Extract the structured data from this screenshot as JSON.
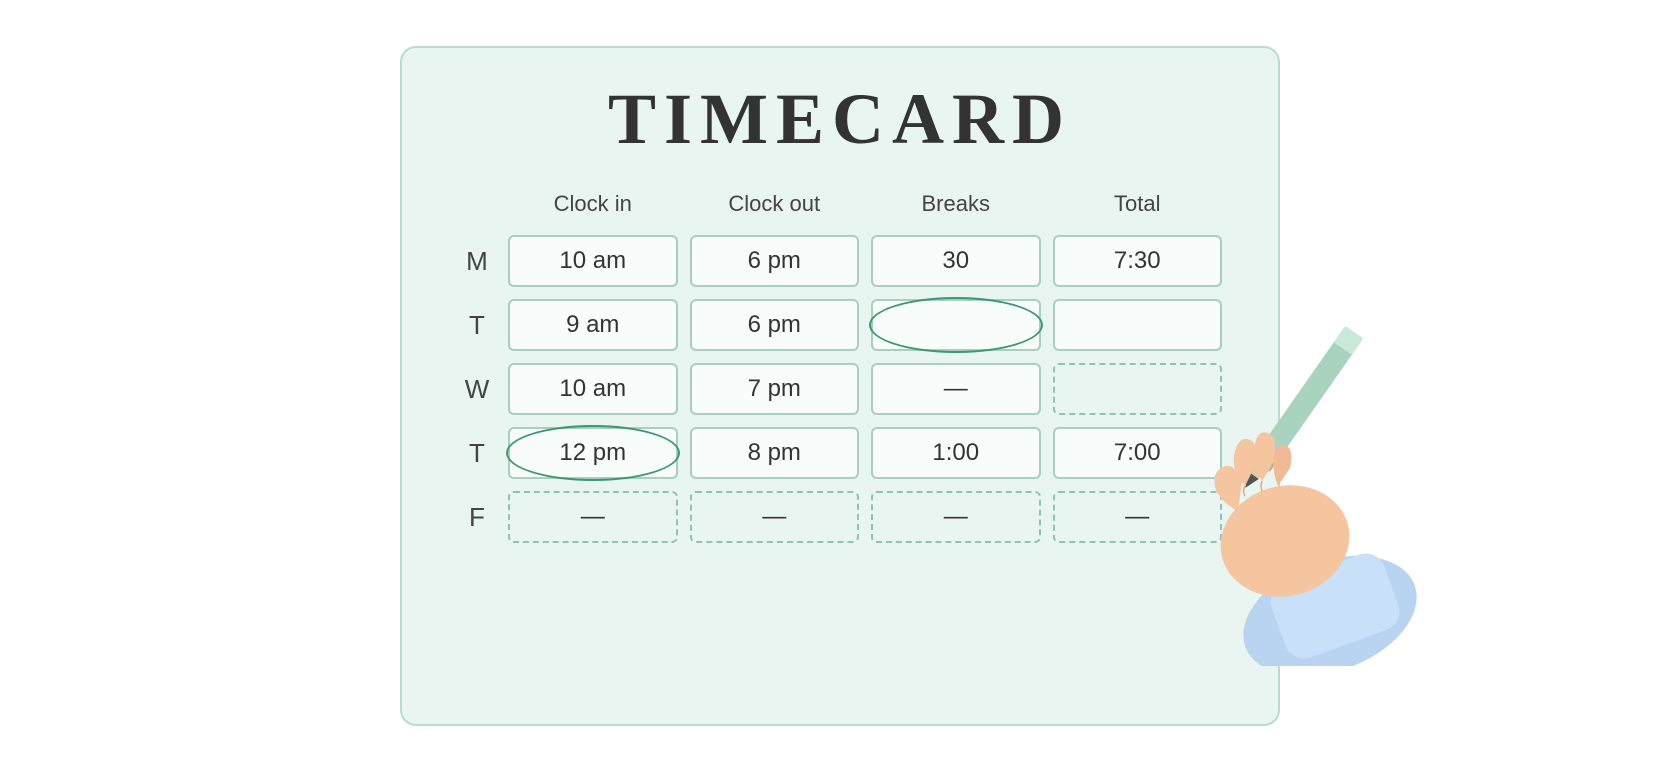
{
  "title": "TIMECARD",
  "columns": {
    "day": "",
    "clock_in": "Clock in",
    "clock_out": "Clock out",
    "breaks": "Breaks",
    "total": "Total"
  },
  "rows": [
    {
      "day": "M",
      "clock_in": "10 am",
      "clock_out": "6 pm",
      "breaks": "30",
      "total": "7:30",
      "clock_in_style": "solid",
      "clock_out_style": "solid",
      "breaks_style": "solid",
      "total_style": "solid",
      "clock_in_circled": false
    },
    {
      "day": "T",
      "clock_in": "9 am",
      "clock_out": "6 pm",
      "breaks": "",
      "total": "",
      "clock_in_style": "solid",
      "clock_out_style": "solid",
      "breaks_style": "solid",
      "total_style": "solid",
      "clock_in_circled": false
    },
    {
      "day": "W",
      "clock_in": "10 am",
      "clock_out": "7 pm",
      "breaks": "—",
      "total": "",
      "clock_in_style": "solid",
      "clock_out_style": "solid",
      "breaks_style": "solid",
      "total_style": "dashed",
      "clock_in_circled": false
    },
    {
      "day": "T",
      "clock_in": "12 pm",
      "clock_out": "8 pm",
      "breaks": "1:00",
      "total": "7:00",
      "clock_in_style": "solid",
      "clock_out_style": "solid",
      "breaks_style": "solid",
      "total_style": "solid",
      "clock_in_circled": true
    },
    {
      "day": "F",
      "clock_in": "—",
      "clock_out": "—",
      "breaks": "—",
      "total": "—",
      "clock_in_style": "dashed",
      "clock_out_style": "dashed",
      "breaks_style": "dashed",
      "total_style": "dashed",
      "clock_in_circled": false
    }
  ]
}
